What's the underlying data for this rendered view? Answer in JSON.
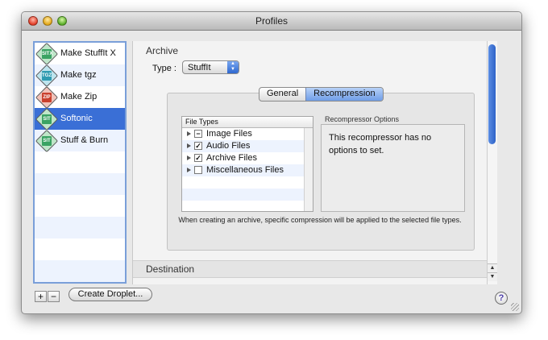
{
  "window": {
    "title": "Profiles"
  },
  "sidebar": {
    "items": [
      {
        "label": "Make StuffIt X",
        "icon": "stuffit-x-icon",
        "color": "#3aa363",
        "tag": "SITX"
      },
      {
        "label": "Make tgz",
        "icon": "tgz-icon",
        "color": "#2f9bb1",
        "tag": "TGZ"
      },
      {
        "label": "Make Zip",
        "icon": "zip-icon",
        "color": "#c9402d",
        "tag": "ZIP"
      },
      {
        "label": "Softonic",
        "icon": "softonic-icon",
        "color": "#3aa363",
        "tag": "SIT"
      },
      {
        "label": "Stuff & Burn",
        "icon": "stuff-burn-icon",
        "color": "#3aa363",
        "tag": "SIT"
      }
    ],
    "selected_index": 3
  },
  "footer": {
    "add_label": "+",
    "remove_label": "−",
    "create_droplet_label": "Create Droplet...",
    "help_label": "?"
  },
  "main": {
    "archive_title": "Archive",
    "type_label": "Type :",
    "type_value": "StuffIt",
    "tabs": [
      {
        "label": "General"
      },
      {
        "label": "Recompression",
        "active": true
      }
    ],
    "file_types": {
      "header": "File Types",
      "rows": [
        {
          "label": "Image Files",
          "state": "mixed"
        },
        {
          "label": "Audio Files",
          "state": "checked"
        },
        {
          "label": "Archive Files",
          "state": "checked"
        },
        {
          "label": "Miscellaneous Files",
          "state": "unchecked"
        }
      ]
    },
    "recompressor": {
      "label": "Recompressor Options",
      "text": "This recompressor has no options to set."
    },
    "note": "When creating an archive, specific compression will be applied to the selected file types.",
    "destination_title": "Destination"
  },
  "colors": {
    "selection": "#3a6fd6",
    "accent": "#2e63c8"
  }
}
